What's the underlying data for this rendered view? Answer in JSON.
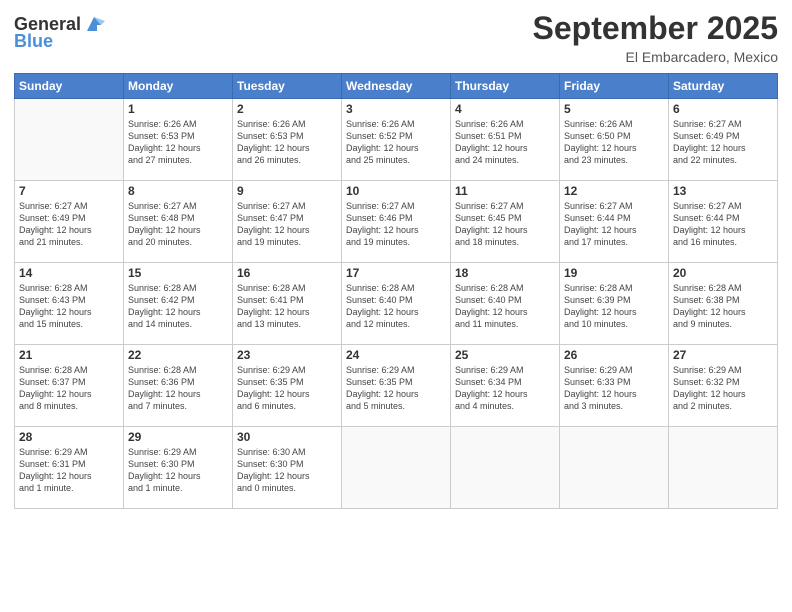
{
  "logo": {
    "general": "General",
    "blue": "Blue"
  },
  "header": {
    "month": "September 2025",
    "location": "El Embarcadero, Mexico"
  },
  "weekdays": [
    "Sunday",
    "Monday",
    "Tuesday",
    "Wednesday",
    "Thursday",
    "Friday",
    "Saturday"
  ],
  "weeks": [
    [
      {
        "day": "",
        "info": ""
      },
      {
        "day": "1",
        "info": "Sunrise: 6:26 AM\nSunset: 6:53 PM\nDaylight: 12 hours\nand 27 minutes."
      },
      {
        "day": "2",
        "info": "Sunrise: 6:26 AM\nSunset: 6:53 PM\nDaylight: 12 hours\nand 26 minutes."
      },
      {
        "day": "3",
        "info": "Sunrise: 6:26 AM\nSunset: 6:52 PM\nDaylight: 12 hours\nand 25 minutes."
      },
      {
        "day": "4",
        "info": "Sunrise: 6:26 AM\nSunset: 6:51 PM\nDaylight: 12 hours\nand 24 minutes."
      },
      {
        "day": "5",
        "info": "Sunrise: 6:26 AM\nSunset: 6:50 PM\nDaylight: 12 hours\nand 23 minutes."
      },
      {
        "day": "6",
        "info": "Sunrise: 6:27 AM\nSunset: 6:49 PM\nDaylight: 12 hours\nand 22 minutes."
      }
    ],
    [
      {
        "day": "7",
        "info": "Sunrise: 6:27 AM\nSunset: 6:49 PM\nDaylight: 12 hours\nand 21 minutes."
      },
      {
        "day": "8",
        "info": "Sunrise: 6:27 AM\nSunset: 6:48 PM\nDaylight: 12 hours\nand 20 minutes."
      },
      {
        "day": "9",
        "info": "Sunrise: 6:27 AM\nSunset: 6:47 PM\nDaylight: 12 hours\nand 19 minutes."
      },
      {
        "day": "10",
        "info": "Sunrise: 6:27 AM\nSunset: 6:46 PM\nDaylight: 12 hours\nand 19 minutes."
      },
      {
        "day": "11",
        "info": "Sunrise: 6:27 AM\nSunset: 6:45 PM\nDaylight: 12 hours\nand 18 minutes."
      },
      {
        "day": "12",
        "info": "Sunrise: 6:27 AM\nSunset: 6:44 PM\nDaylight: 12 hours\nand 17 minutes."
      },
      {
        "day": "13",
        "info": "Sunrise: 6:27 AM\nSunset: 6:44 PM\nDaylight: 12 hours\nand 16 minutes."
      }
    ],
    [
      {
        "day": "14",
        "info": "Sunrise: 6:28 AM\nSunset: 6:43 PM\nDaylight: 12 hours\nand 15 minutes."
      },
      {
        "day": "15",
        "info": "Sunrise: 6:28 AM\nSunset: 6:42 PM\nDaylight: 12 hours\nand 14 minutes."
      },
      {
        "day": "16",
        "info": "Sunrise: 6:28 AM\nSunset: 6:41 PM\nDaylight: 12 hours\nand 13 minutes."
      },
      {
        "day": "17",
        "info": "Sunrise: 6:28 AM\nSunset: 6:40 PM\nDaylight: 12 hours\nand 12 minutes."
      },
      {
        "day": "18",
        "info": "Sunrise: 6:28 AM\nSunset: 6:40 PM\nDaylight: 12 hours\nand 11 minutes."
      },
      {
        "day": "19",
        "info": "Sunrise: 6:28 AM\nSunset: 6:39 PM\nDaylight: 12 hours\nand 10 minutes."
      },
      {
        "day": "20",
        "info": "Sunrise: 6:28 AM\nSunset: 6:38 PM\nDaylight: 12 hours\nand 9 minutes."
      }
    ],
    [
      {
        "day": "21",
        "info": "Sunrise: 6:28 AM\nSunset: 6:37 PM\nDaylight: 12 hours\nand 8 minutes."
      },
      {
        "day": "22",
        "info": "Sunrise: 6:28 AM\nSunset: 6:36 PM\nDaylight: 12 hours\nand 7 minutes."
      },
      {
        "day": "23",
        "info": "Sunrise: 6:29 AM\nSunset: 6:35 PM\nDaylight: 12 hours\nand 6 minutes."
      },
      {
        "day": "24",
        "info": "Sunrise: 6:29 AM\nSunset: 6:35 PM\nDaylight: 12 hours\nand 5 minutes."
      },
      {
        "day": "25",
        "info": "Sunrise: 6:29 AM\nSunset: 6:34 PM\nDaylight: 12 hours\nand 4 minutes."
      },
      {
        "day": "26",
        "info": "Sunrise: 6:29 AM\nSunset: 6:33 PM\nDaylight: 12 hours\nand 3 minutes."
      },
      {
        "day": "27",
        "info": "Sunrise: 6:29 AM\nSunset: 6:32 PM\nDaylight: 12 hours\nand 2 minutes."
      }
    ],
    [
      {
        "day": "28",
        "info": "Sunrise: 6:29 AM\nSunset: 6:31 PM\nDaylight: 12 hours\nand 1 minute."
      },
      {
        "day": "29",
        "info": "Sunrise: 6:29 AM\nSunset: 6:30 PM\nDaylight: 12 hours\nand 1 minute."
      },
      {
        "day": "30",
        "info": "Sunrise: 6:30 AM\nSunset: 6:30 PM\nDaylight: 12 hours\nand 0 minutes."
      },
      {
        "day": "",
        "info": ""
      },
      {
        "day": "",
        "info": ""
      },
      {
        "day": "",
        "info": ""
      },
      {
        "day": "",
        "info": ""
      }
    ]
  ]
}
